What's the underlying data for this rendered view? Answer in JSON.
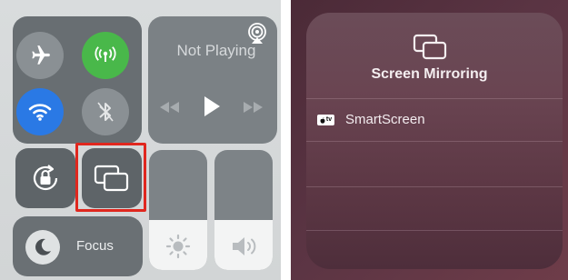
{
  "control_center": {
    "now_playing": {
      "label": "Not Playing"
    },
    "focus": {
      "label": "Focus"
    },
    "sliders": {
      "brightness_level": 0.42,
      "volume_level": 0.42
    },
    "highlight_color": "#e0271e",
    "icons": {
      "airplane": "airplane-icon",
      "cellular": "cellular-antenna-icon",
      "wifi": "wifi-icon",
      "bluetooth": "bluetooth-icon",
      "airplay": "airplay-icon",
      "rewind": "rewind-icon",
      "play": "play-icon",
      "forward": "fast-forward-icon",
      "orientation_lock": "orientation-lock-icon",
      "screen_mirroring": "screen-mirroring-icon",
      "brightness": "sun-icon",
      "volume": "speaker-icon",
      "moon": "moon-icon"
    },
    "colors": {
      "cellular_on": "#49b84a",
      "wifi_on": "#2a79e5"
    }
  },
  "screen_mirroring": {
    "title": "Screen Mirroring",
    "devices": [
      {
        "badge": "tv",
        "name": "SmartScreen"
      }
    ]
  }
}
